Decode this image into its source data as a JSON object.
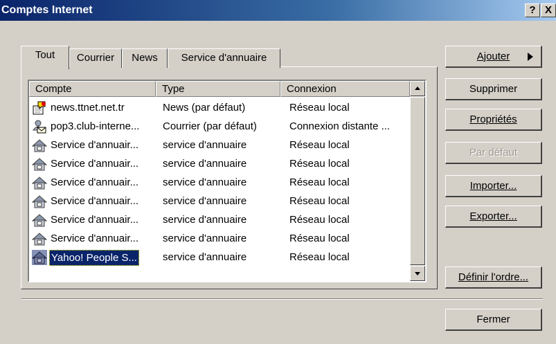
{
  "window": {
    "title": "Comptes Internet",
    "help_label": "?",
    "close_label": "X"
  },
  "tabs": [
    {
      "label": "Tout"
    },
    {
      "label": "Courrier"
    },
    {
      "label": "News"
    },
    {
      "label": "Service d'annuaire"
    }
  ],
  "list": {
    "columns": [
      "Compte",
      "Type",
      "Connexion"
    ],
    "rows": [
      {
        "icon": "news-account-icon",
        "compte": "news.ttnet.net.tr",
        "type": "News (par défaut)",
        "connexion": "Réseau local"
      },
      {
        "icon": "mail-account-icon",
        "compte": "pop3.club-interne...",
        "type": "Courrier (par défaut)",
        "connexion": "Connexion distante ..."
      },
      {
        "icon": "directory-service-icon",
        "compte": "Service d'annuair...",
        "type": "service d'annuaire",
        "connexion": "Réseau local"
      },
      {
        "icon": "directory-service-icon",
        "compte": "Service d'annuair...",
        "type": "service d'annuaire",
        "connexion": "Réseau local"
      },
      {
        "icon": "directory-service-icon",
        "compte": "Service d'annuair...",
        "type": "service d'annuaire",
        "connexion": "Réseau local"
      },
      {
        "icon": "directory-service-icon",
        "compte": "Service d'annuair...",
        "type": "service d'annuaire",
        "connexion": "Réseau local"
      },
      {
        "icon": "directory-service-icon",
        "compte": "Service d'annuair...",
        "type": "service d'annuaire",
        "connexion": "Réseau local"
      },
      {
        "icon": "directory-service-icon",
        "compte": "Service d'annuair...",
        "type": "service d'annuaire",
        "connexion": "Réseau local"
      },
      {
        "icon": "directory-service-icon",
        "compte": "Yahoo! People S...",
        "type": "service d'annuaire",
        "connexion": "Réseau local"
      }
    ]
  },
  "buttons": {
    "ajouter": "Ajouter",
    "supprimer": "Supprimer",
    "proprietes": "Propriétés",
    "par_defaut": "Par défaut",
    "importer": "Importer...",
    "exporter": "Exporter...",
    "definir_ordre": "Définir l'ordre...",
    "fermer": "Fermer"
  },
  "colors": {
    "selection": "#0a246a",
    "face": "#d4d0c8",
    "title_start": "#0a246a",
    "title_end": "#a6caf0"
  }
}
